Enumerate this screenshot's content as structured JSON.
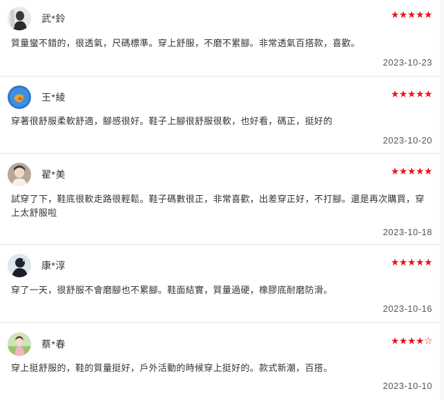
{
  "reviews": [
    {
      "username": "武*鈴",
      "rating": 5,
      "text": "質量蠻不錯的，很透氣，尺碼標準。穿上舒服，不磨不累腳。非常透氣百搭款，喜歡。",
      "date": "2023-10-23"
    },
    {
      "username": "王*綾",
      "rating": 5,
      "text": "穿著很舒服柔軟舒適，腳感很好。鞋子上腳很舒服很軟，也好看，碼正，挺好的",
      "date": "2023-10-20"
    },
    {
      "username": "翟*美",
      "rating": 5,
      "text": "試穿了下，鞋底很軟走路很輕鬆。鞋子碼數很正，非常喜歡，出差穿正好，不打腳。還是再次購買，穿上太舒服啦",
      "date": "2023-10-18"
    },
    {
      "username": "康*淳",
      "rating": 5,
      "text": "穿了一天，很舒服不會磨腳也不累腳。鞋面結實，質量過硬，橡膠底耐磨防滑。",
      "date": "2023-10-16"
    },
    {
      "username": "蔡*春",
      "rating": 4,
      "text": "穿上挺舒服的，鞋的質量挺好，戶外活動的時候穿上挺好的。款式新潮，百搭。",
      "date": "2023-10-10"
    }
  ],
  "icons": {
    "star_filled": "★",
    "star_empty": "☆"
  },
  "colors": {
    "star": "#e8141c",
    "divider": "#e6e6e6",
    "text": "#333333"
  }
}
